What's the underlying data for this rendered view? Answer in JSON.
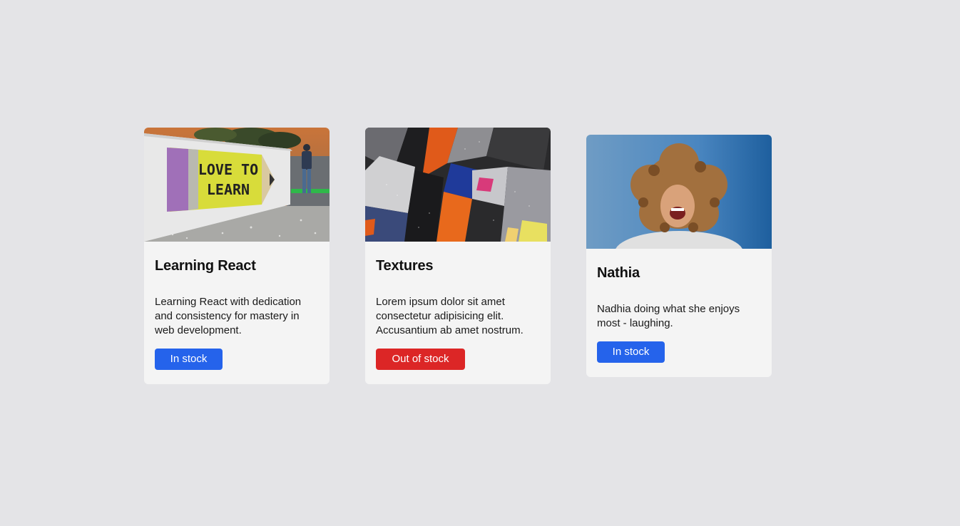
{
  "colors": {
    "page_background": "#e4e4e7",
    "card_background": "#f4f4f4",
    "in_stock": "#2563eb",
    "out_of_stock": "#dc2626"
  },
  "cards": [
    {
      "title": "Learning React",
      "description": "Learning React with dedication and consistency for mastery in web development.",
      "badge": "In stock",
      "badge_status": "in-stock",
      "image_icon": "love-to-learn-pencil-sign-photo",
      "image_text": "LOVE TO LEARN"
    },
    {
      "title": "Textures",
      "description": "Lorem ipsum dolor sit amet consectetur adipisicing elit. Accusantium ab amet nostrum.",
      "badge": "Out of stock",
      "badge_status": "out-of-stock",
      "image_icon": "abstract-paint-texture-photo"
    },
    {
      "title": "Nathia",
      "description": "Nadhia doing what she enjoys most - laughing.",
      "badge": "In stock",
      "badge_status": "in-stock",
      "image_icon": "laughing-woman-portrait-photo"
    }
  ]
}
